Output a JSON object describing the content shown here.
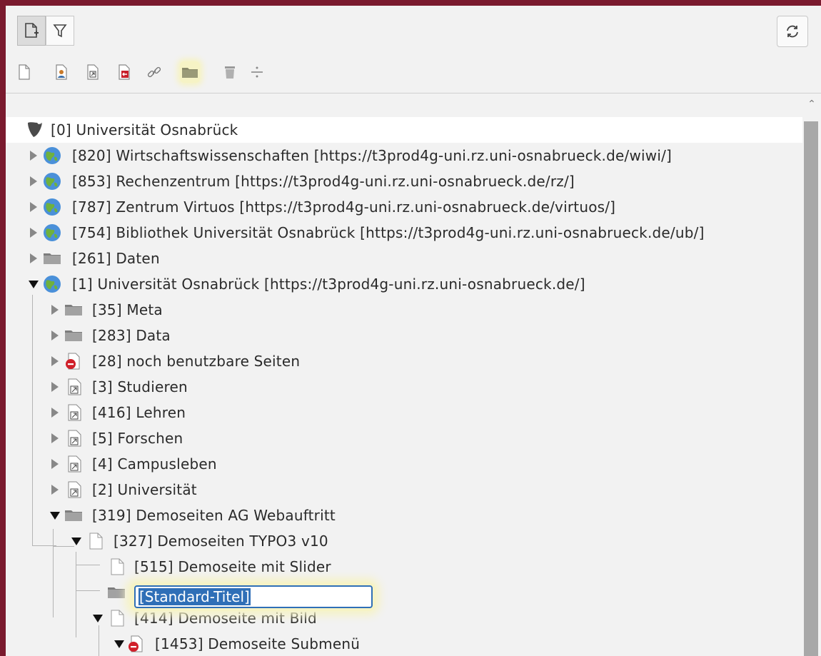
{
  "toolbar": {
    "new_page_icon": "new-page-icon",
    "filter_icon": "filter-icon",
    "refresh_icon": "refresh-icon",
    "doctypes": [
      "standard-page-icon",
      "backend-user-page-icon",
      "shortcut-page-icon",
      "external-link-page-icon",
      "link-icon",
      "folder-icon",
      "recycler-icon",
      "separator-icon"
    ]
  },
  "tree": {
    "root": "[0] Universität Osnabrück",
    "items": [
      {
        "label": "[820] Wirtschaftswissenschaften [https://t3prod4g-uni.rz.uni-osnabrueck.de/wiwi/]"
      },
      {
        "label": "[853] Rechenzentrum [https://t3prod4g-uni.rz.uni-osnabrueck.de/rz/]"
      },
      {
        "label": "[787] Zentrum Virtuos [https://t3prod4g-uni.rz.uni-osnabrueck.de/virtuos/]"
      },
      {
        "label": "[754] Bibliothek Universität Osnabrück [https://t3prod4g-uni.rz.uni-osnabrueck.de/ub/]"
      },
      {
        "label": "[261] Daten"
      },
      {
        "label": "[1] Universität Osnabrück [https://t3prod4g-uni.rz.uni-osnabrueck.de/]"
      },
      {
        "label": "[35] Meta"
      },
      {
        "label": "[283] Data"
      },
      {
        "label": "[28] noch benutzbare Seiten"
      },
      {
        "label": "[3] Studieren"
      },
      {
        "label": "[416] Lehren"
      },
      {
        "label": "[5] Forschen"
      },
      {
        "label": "[4] Campusleben"
      },
      {
        "label": "[2] Universität"
      },
      {
        "label": "[319] Demoseiten AG Webauftritt"
      },
      {
        "label": "[327] Demoseiten TYPO3 v10"
      },
      {
        "label": "[515] Demoseite mit Slider"
      },
      {
        "label": "[414] Demoseite mit Bild"
      },
      {
        "label": "[1453] Demoseite Submenü"
      }
    ],
    "edit_value": "[Standard-Titel]"
  }
}
